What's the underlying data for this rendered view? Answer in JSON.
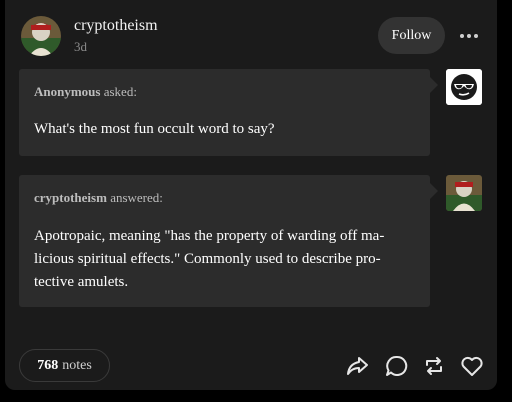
{
  "post": {
    "username": "cryptotheism",
    "time_ago": "3d",
    "follow_label": "Follow"
  },
  "question": {
    "asker": "Anonymous",
    "asked_suffix": "asked:",
    "text": "What's the most fun occult word to say?"
  },
  "answer": {
    "answerer": "cryptotheism",
    "answered_suffix": "answered:",
    "text": "Apotropaic, meaning \"has the property of warding off ma-licious spiritual effects.\" Commonly used to describe pro-tective amulets."
  },
  "footer": {
    "notes_count": "768",
    "notes_label": "notes"
  },
  "icons": [
    "avatar-image",
    "more-options-icon",
    "anonymous-sunglasses-icon",
    "share-icon",
    "reply-icon",
    "reblog-icon",
    "like-icon"
  ],
  "colors": {
    "background": "#000000",
    "card": "#1b1b1b",
    "bubble": "#2c2c2c",
    "follow_button": "#333333"
  }
}
